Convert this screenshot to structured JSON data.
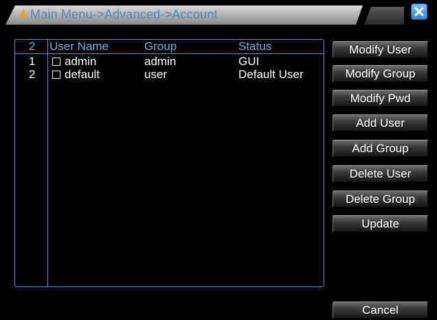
{
  "window": {
    "title": "Main Menu->Advanced->Account"
  },
  "table": {
    "count": "2",
    "headers": {
      "user_name": "User Name",
      "group": "Group",
      "status": "Status"
    },
    "rows": [
      {
        "index": "1",
        "user_name": "admin",
        "group": "admin",
        "status": "GUI",
        "checked": false
      },
      {
        "index": "2",
        "user_name": "default",
        "group": "user",
        "status": "Default User",
        "checked": false
      }
    ]
  },
  "buttons": {
    "modify_user": "Modify User",
    "modify_group": "Modify Group",
    "modify_pwd": "Modify Pwd",
    "add_user": "Add User",
    "add_group": "Add Group",
    "delete_user": "Delete User",
    "delete_group": "Delete Group",
    "update": "Update",
    "cancel": "Cancel"
  },
  "icons": {
    "title_icon": "people-icon",
    "close_icon": "close-icon"
  },
  "colors": {
    "accent": "#4e97d8",
    "title_text": "#4f88c0",
    "close_button": "#2f86d6"
  }
}
